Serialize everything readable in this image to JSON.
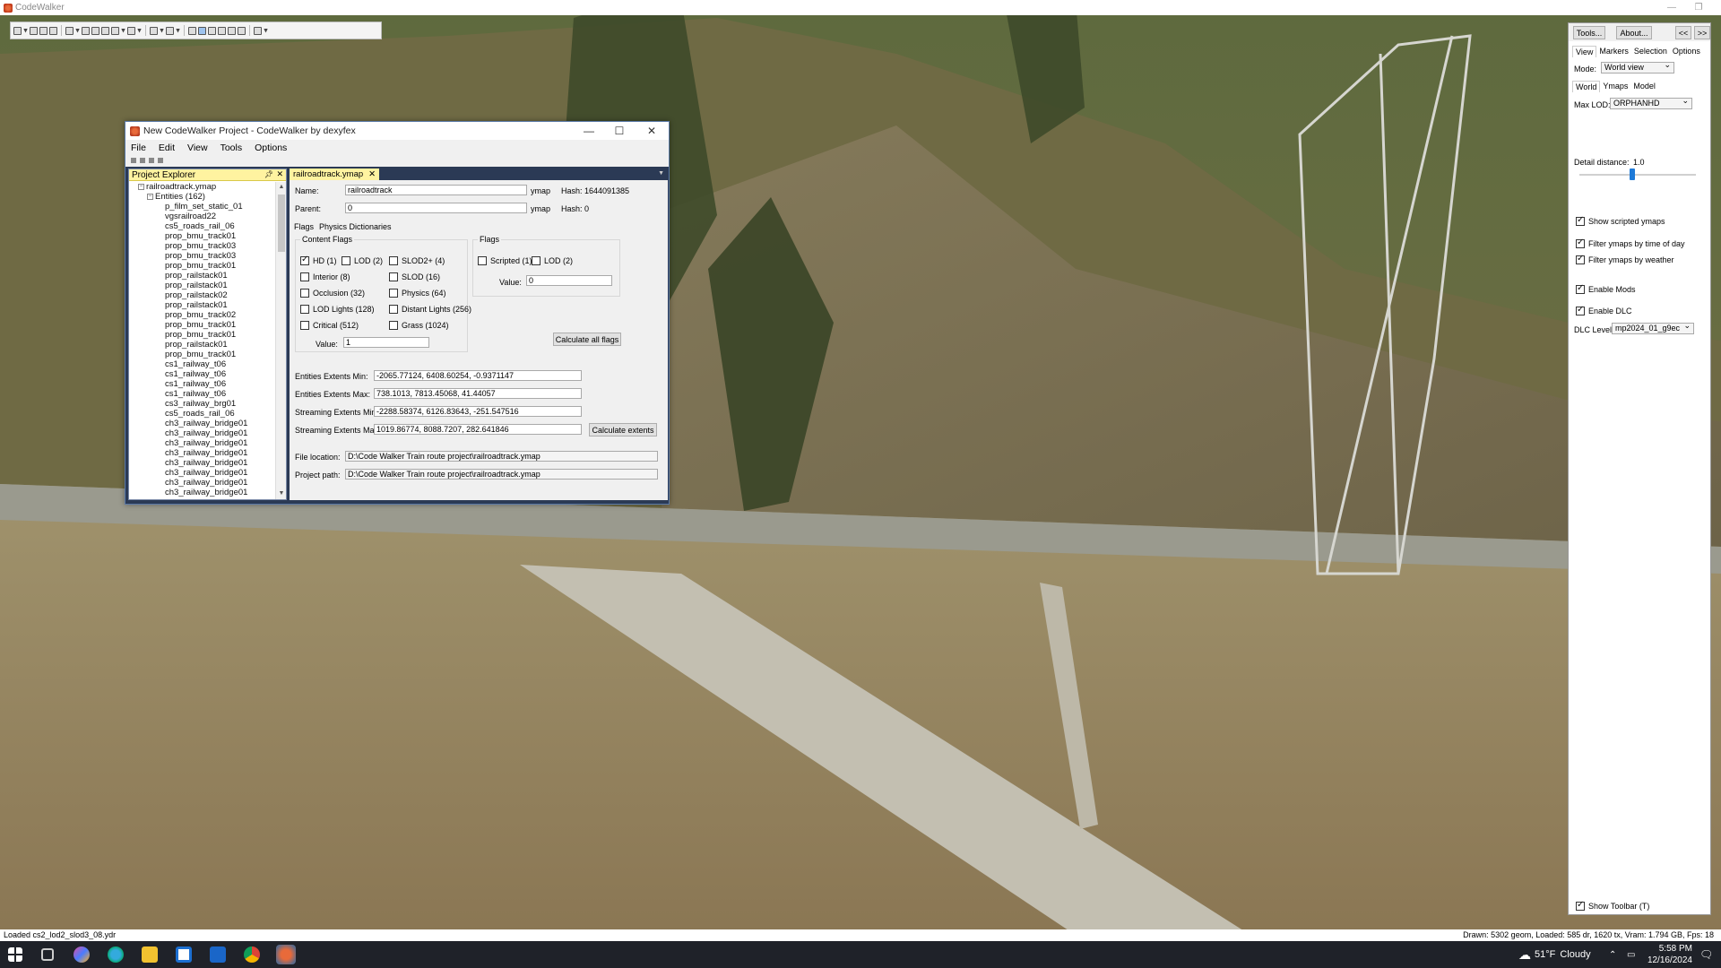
{
  "app": {
    "title": "CodeWalker",
    "status_left": "Loaded cs2_lod2_slod3_08.ydr",
    "status_right": "Drawn: 5302 geom, Loaded: 585 dr, 1620 tx, Vram: 1.794 GB, Fps: 18"
  },
  "project_window": {
    "title": "New CodeWalker Project - CodeWalker by dexyfex",
    "menu": [
      "File",
      "Edit",
      "View",
      "Tools",
      "Options"
    ],
    "explorer": {
      "header": "Project Explorer",
      "root": "railroadtrack.ymap",
      "entities_node": "Entities (162)",
      "items": [
        "p_film_set_static_01",
        "vgsrailroad22",
        "cs5_roads_rail_06",
        "prop_bmu_track01",
        "prop_bmu_track03",
        "prop_bmu_track03",
        "prop_bmu_track01",
        "prop_railstack01",
        "prop_railstack01",
        "prop_railstack02",
        "prop_railstack01",
        "prop_bmu_track02",
        "prop_bmu_track01",
        "prop_bmu_track01",
        "prop_railstack01",
        "prop_bmu_track01",
        "cs1_railway_t06",
        "cs1_railway_t06",
        "cs1_railway_t06",
        "cs1_railway_t06",
        "cs3_railway_brg01",
        "cs5_roads_rail_06",
        "ch3_railway_bridge01",
        "ch3_railway_bridge01",
        "ch3_railway_bridge01",
        "ch3_railway_bridge01",
        "ch3_railway_bridge01",
        "ch3_railway_bridge01",
        "ch3_railway_bridge01",
        "ch3_railway_bridge01"
      ]
    },
    "editor": {
      "tab": "railroadtrack.ymap",
      "name_label": "Name:",
      "name_value": "railroadtrack",
      "ext1": "ymap",
      "hash1": "Hash: 1644091385",
      "parent_label": "Parent:",
      "parent_value": "0",
      "ext2": "ymap",
      "hash2": "Hash: 0",
      "subtabs": [
        "Flags",
        "Physics Dictionaries"
      ],
      "content_flags_title": "Content Flags",
      "content_flags": [
        {
          "label": "HD (1)",
          "checked": true
        },
        {
          "label": "LOD (2)",
          "checked": false
        },
        {
          "label": "SLOD2+ (4)",
          "checked": false
        },
        {
          "label": "Interior (8)",
          "checked": false
        },
        {
          "label": "SLOD (16)",
          "checked": false
        },
        {
          "label": "Occlusion (32)",
          "checked": false
        },
        {
          "label": "Physics (64)",
          "checked": false
        },
        {
          "label": "LOD Lights (128)",
          "checked": false
        },
        {
          "label": "Distant Lights (256)",
          "checked": false
        },
        {
          "label": "Critical (512)",
          "checked": false
        },
        {
          "label": "Grass (1024)",
          "checked": false
        }
      ],
      "content_value_label": "Value:",
      "content_value": "1",
      "flags_title": "Flags",
      "flags": [
        {
          "label": "Scripted (1)",
          "checked": false
        },
        {
          "label": "LOD (2)",
          "checked": false
        }
      ],
      "flags_value_label": "Value:",
      "flags_value": "0",
      "calc_flags_btn": "Calculate all flags",
      "ent_min_label": "Entities Extents Min:",
      "ent_min": "-2065.77124, 6408.60254, -0.9371147",
      "ent_max_label": "Entities Extents Max:",
      "ent_max": "738.1013, 7813.45068, 41.44057",
      "str_min_label": "Streaming Extents Min:",
      "str_min": "-2288.58374, 6126.83643, -251.547516",
      "str_max_label": "Streaming Extents Max:",
      "str_max": "1019.86774, 8088.7207, 282.641846",
      "calc_extents_btn": "Calculate extents",
      "file_loc_label": "File location:",
      "file_loc": "D:\\Code Walker Train route project\\railroadtrack.ymap",
      "proj_path_label": "Project path:",
      "proj_path": "D:\\Code Walker Train route project\\railroadtrack.ymap"
    }
  },
  "right_panel": {
    "tools_btn": "Tools...",
    "about_btn": "About...",
    "collapse_btn": "<<",
    "expand_btn": ">>",
    "tabs": [
      "View",
      "Markers",
      "Selection",
      "Options"
    ],
    "mode_label": "Mode:",
    "mode_value": "World view",
    "subtabs": [
      "World",
      "Ymaps",
      "Model"
    ],
    "maxlod_label": "Max LOD:",
    "maxlod_value": "ORPHANHD",
    "detail_label": "Detail distance:",
    "detail_value": "1.0",
    "detail_level": 0.45,
    "options": [
      {
        "label": "Show scripted ymaps",
        "checked": true
      },
      {
        "label": "Filter ymaps by time of day",
        "checked": true
      },
      {
        "label": "Filter ymaps by weather",
        "checked": true
      },
      {
        "label": "Enable Mods",
        "checked": true
      },
      {
        "label": "Enable DLC",
        "checked": true
      }
    ],
    "dlc_label": "DLC Level",
    "dlc_value": "mp2024_01_g9ec",
    "show_toolbar": {
      "label": "Show Toolbar (T)",
      "checked": true
    }
  },
  "taskbar": {
    "weather_temp": "51°F",
    "weather_desc": "Cloudy",
    "time": "5:58 PM",
    "date": "12/16/2024"
  }
}
